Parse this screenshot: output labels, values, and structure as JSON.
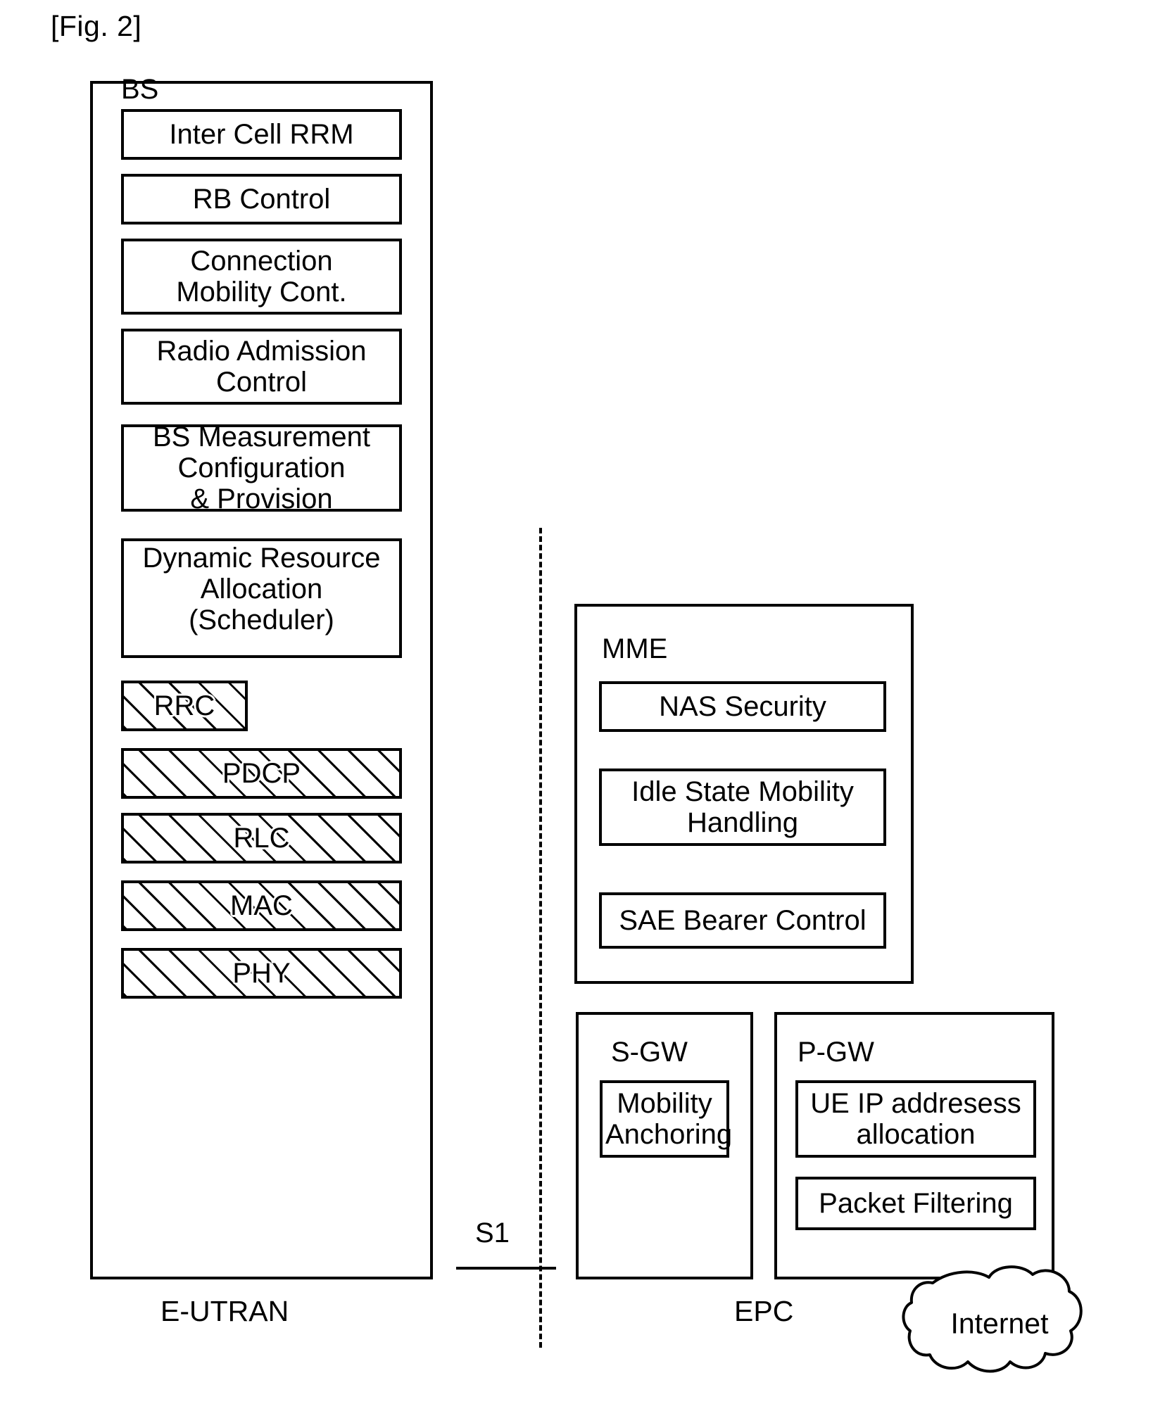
{
  "figure": {
    "label": "[Fig. 2]"
  },
  "eutran": {
    "caption": "E-UTRAN",
    "bs": {
      "title": "BS",
      "functions": [
        {
          "label": "Inter Cell RRM"
        },
        {
          "label": "RB Control"
        },
        {
          "label": "Connection\nMobility Cont."
        },
        {
          "label": "Radio Admission\nControl"
        },
        {
          "label": "BS Measurement\nConfiguration\n& Provision"
        },
        {
          "label": "Dynamic Resource\nAllocation\n(Scheduler)"
        }
      ],
      "protocol_layers": [
        {
          "label": "RRC"
        },
        {
          "label": "PDCP"
        },
        {
          "label": "RLC"
        },
        {
          "label": "MAC"
        },
        {
          "label": "PHY"
        }
      ]
    }
  },
  "interface": {
    "s1_label": "S1"
  },
  "epc": {
    "caption": "EPC",
    "mme": {
      "title": "MME",
      "functions": [
        {
          "label": "NAS Security"
        },
        {
          "label": "Idle State Mobility\nHandling"
        },
        {
          "label": "SAE Bearer Control"
        }
      ]
    },
    "sgw": {
      "title": "S-GW",
      "functions": [
        {
          "label": "Mobility\nAnchoring"
        }
      ]
    },
    "pgw": {
      "title": "P-GW",
      "functions": [
        {
          "label": "UE IP addresess\nallocation"
        },
        {
          "label": "Packet Filtering"
        }
      ]
    }
  },
  "internet": {
    "label": "Internet"
  },
  "colors": {
    "stroke": "#000000",
    "background": "#ffffff"
  }
}
